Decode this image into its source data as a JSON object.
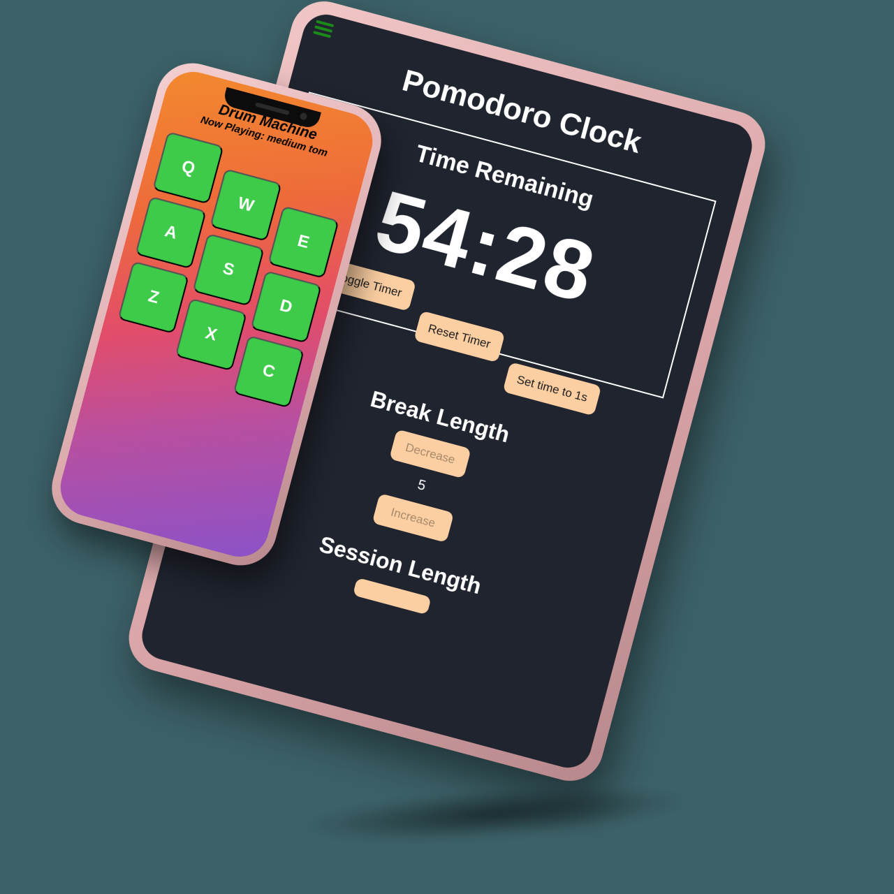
{
  "tablet": {
    "title": "Pomodoro Clock",
    "timer": {
      "heading": "Time Remaining",
      "value": "54:28",
      "buttons": {
        "toggle": "Toggle Timer",
        "reset": "Reset Timer",
        "set1s": "Set time to 1s"
      }
    },
    "break": {
      "heading": "Break Length",
      "decrease": "Decrease",
      "value": "5",
      "increase": "Increase"
    },
    "session": {
      "heading": "Session Length"
    }
  },
  "phone": {
    "title": "Drum Machine",
    "now_playing": "Now Playing: medium tom",
    "pads": [
      "Q",
      "W",
      "E",
      "A",
      "S",
      "D",
      "Z",
      "X",
      "C"
    ]
  }
}
